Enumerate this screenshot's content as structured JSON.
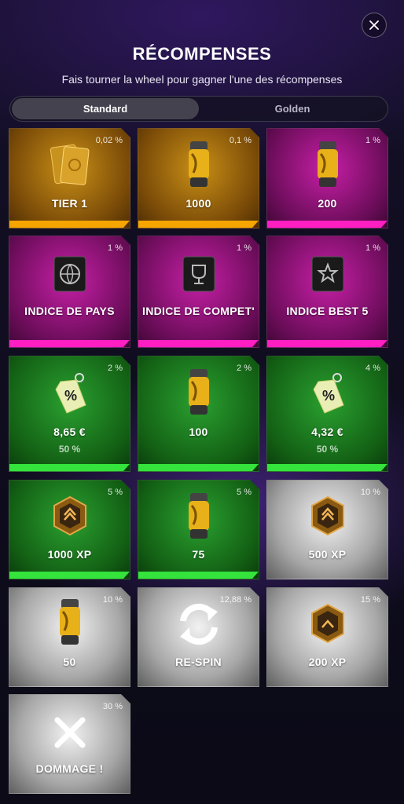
{
  "header": {
    "title": "RÉCOMPENSES",
    "subtitle": "Fais tourner la wheel pour gagner l'une des récompenses",
    "close_icon": "close-icon"
  },
  "tabs": [
    {
      "label": "Standard",
      "active": true
    },
    {
      "label": "Golden",
      "active": false
    }
  ],
  "rewards": [
    {
      "label": "TIER 1",
      "pct": "0,02 %",
      "theme": "gold",
      "icon": "card-pack-icon"
    },
    {
      "label": "1000",
      "pct": "0,1 %",
      "theme": "gold",
      "icon": "capsule-icon"
    },
    {
      "label": "200",
      "pct": "1 %",
      "theme": "pink",
      "icon": "capsule-icon"
    },
    {
      "label": "INDICE DE PAYS",
      "pct": "1 %",
      "theme": "pink",
      "icon": "globe-chip-icon"
    },
    {
      "label": "INDICE DE COMPET'",
      "pct": "1 %",
      "theme": "pink",
      "icon": "trophy-chip-icon"
    },
    {
      "label": "INDICE BEST 5",
      "pct": "1 %",
      "theme": "pink",
      "icon": "star-chip-icon"
    },
    {
      "label": "8,65 €",
      "sub": "50 %",
      "pct": "2 %",
      "theme": "green",
      "icon": "discount-tag-icon"
    },
    {
      "label": "100",
      "pct": "2 %",
      "theme": "green",
      "icon": "capsule-icon"
    },
    {
      "label": "4,32 €",
      "sub": "50 %",
      "pct": "4 %",
      "theme": "green",
      "icon": "discount-tag-icon"
    },
    {
      "label": "1000 XP",
      "pct": "5 %",
      "theme": "green",
      "icon": "xp-badge-icon"
    },
    {
      "label": "75",
      "pct": "5 %",
      "theme": "green",
      "icon": "capsule-icon"
    },
    {
      "label": "500 XP",
      "pct": "10 %",
      "theme": "grey",
      "icon": "xp-badge-icon"
    },
    {
      "label": "50",
      "pct": "10 %",
      "theme": "grey",
      "icon": "capsule-icon"
    },
    {
      "label": "RE-SPIN",
      "pct": "12,88 %",
      "theme": "grey",
      "icon": "respin-icon"
    },
    {
      "label": "200 XP",
      "pct": "15 %",
      "theme": "grey",
      "icon": "xp-badge-icon"
    },
    {
      "label": "DOMMAGE !",
      "pct": "30 %",
      "theme": "grey",
      "icon": "cross-icon"
    }
  ],
  "colors": {
    "gold_accent": "#f5a400",
    "pink_accent": "#ff1ec2",
    "green_accent": "#34e33b"
  }
}
